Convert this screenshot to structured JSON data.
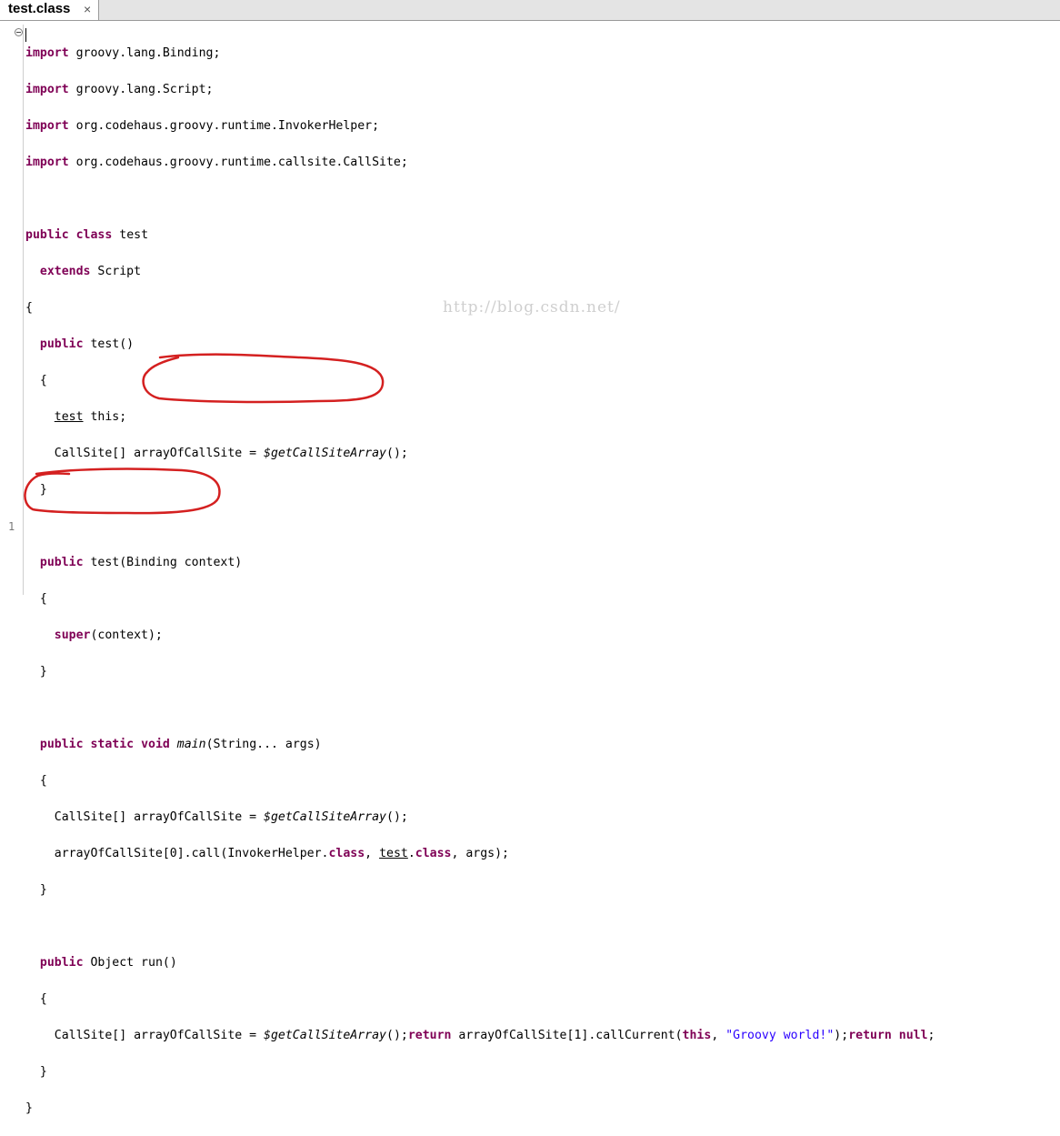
{
  "tab": {
    "title": "test.class",
    "close": "×"
  },
  "watermark": "http://blog.csdn.net/",
  "line_number": "1",
  "code": {
    "l1": [
      "import",
      "groovy.lang.Binding;"
    ],
    "l2": [
      "import",
      "groovy.lang.Script;"
    ],
    "l3": [
      "import",
      "org.codehaus.groovy.runtime.InvokerHelper;"
    ],
    "l4": [
      "import",
      "org.codehaus.groovy.runtime.callsite.CallSite;"
    ],
    "l6": [
      "public",
      "class",
      "test"
    ],
    "l7": [
      "extends",
      "Script"
    ],
    "l8": "{",
    "l9": [
      "public",
      "test()"
    ],
    "l10": "{",
    "l11": [
      "test",
      "this;"
    ],
    "l12": [
      "CallSite[] arrayOfCallSite = ",
      "$getCallSiteArray",
      "();"
    ],
    "l13": "}",
    "l15": [
      "public",
      "test(Binding context)"
    ],
    "l16": "{",
    "l17": [
      "super",
      "(context);"
    ],
    "l18": "}",
    "l20": [
      "public",
      "static",
      "void",
      "main",
      "(String... args)"
    ],
    "l21": "{",
    "l22": [
      "CallSite[] arrayOfCallSite = ",
      "$getCallSiteArray",
      "();"
    ],
    "l23": [
      "arrayOfCallSite[0].call(InvokerHelper.",
      "class",
      ", ",
      "test",
      ".",
      "class",
      ", args);"
    ],
    "l24": "}",
    "l26": [
      "public",
      "Object run()"
    ],
    "l27": "{",
    "l28": [
      "CallSite[] arrayOfCallSite = ",
      "$getCallSiteArray",
      "();",
      "return",
      " arrayOfCallSite[1].callCurrent(",
      "this",
      ", ",
      "\"Groovy world!\"",
      ");",
      "return",
      "null",
      ";"
    ],
    "l29": "}",
    "l30": "}"
  },
  "colors": {
    "keyword": "#7f0055",
    "string": "#2a00ff",
    "annotation": "#d42020"
  }
}
